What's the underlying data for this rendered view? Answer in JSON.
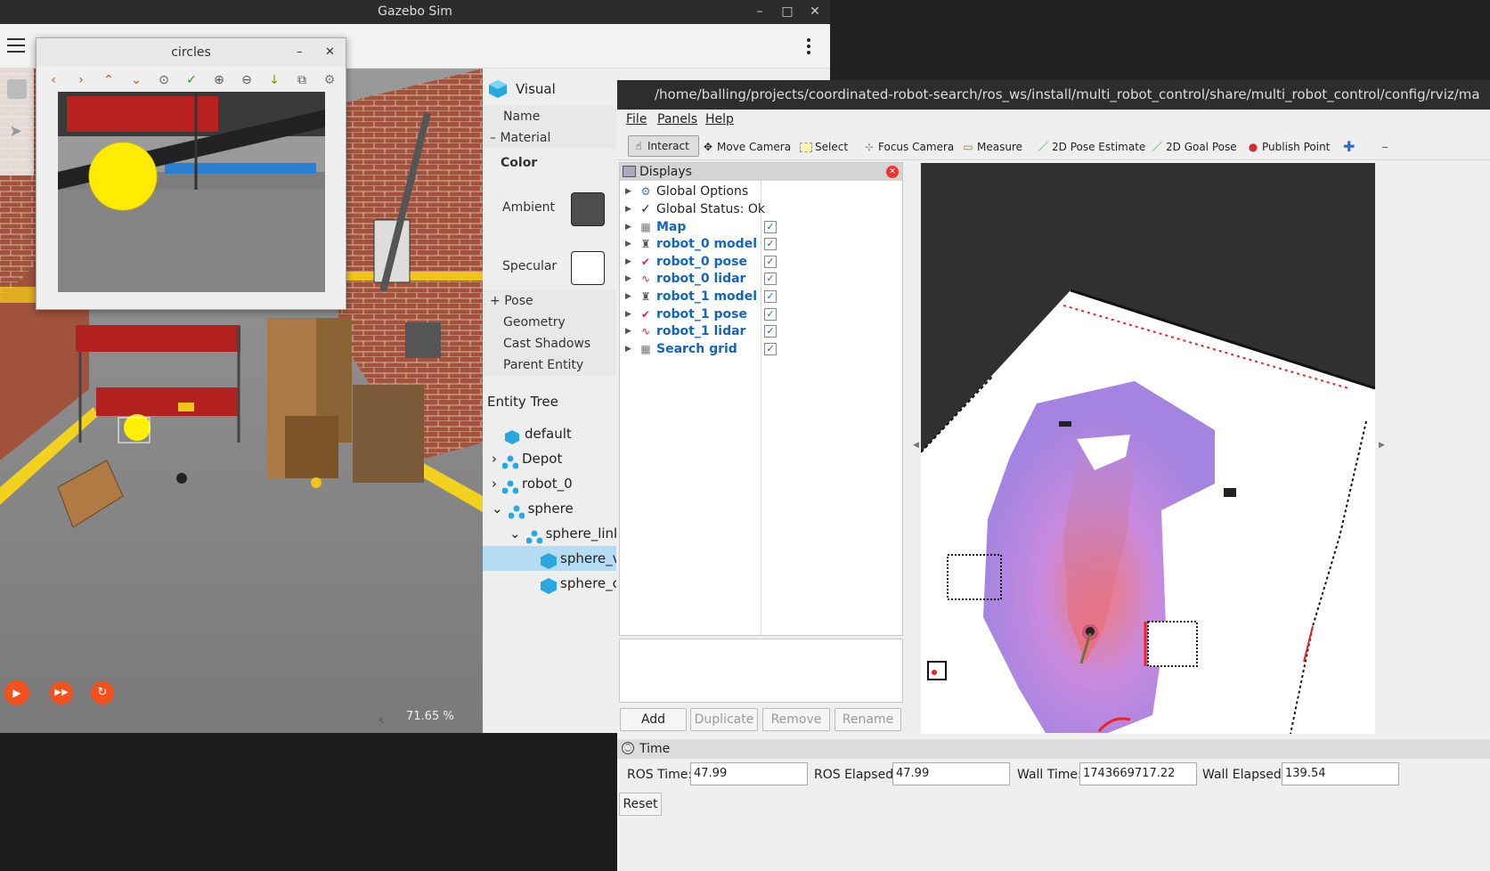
{
  "desktop": {
    "bg": "#1f1f1f"
  },
  "gazebo": {
    "title": "Gazebo Sim",
    "window_controls": [
      "–",
      "□",
      "✕"
    ],
    "menu_icon": "hamburger-icon",
    "more_icon": "kebab-icon",
    "zoom": "71.65 %",
    "collapse_arrow": "‹",
    "play_controls": [
      "play-icon",
      "step-icon",
      "reset-icon"
    ],
    "left_tools": [
      "box-icon",
      "cursor-icon"
    ],
    "component": {
      "section": "Visual",
      "name_label": "Name",
      "material_label": "Material",
      "material_toggle": "–",
      "color_label": "Color",
      "ambient_label": "Ambient",
      "ambient_color": "#4d4d4d",
      "specular_label": "Specular",
      "specular_color": "#ffffff",
      "pose_label": "Pose",
      "pose_toggle": "+",
      "geometry_label": "Geometry",
      "cast_shadows_label": "Cast Shadows",
      "parent_entity_label": "Parent Entity"
    },
    "entity_tree": {
      "title": "Entity Tree",
      "items": [
        {
          "label": "default",
          "chevron": "",
          "icon": "cube-icon"
        },
        {
          "label": "Depot",
          "chevron": "›",
          "icon": "model-icon"
        },
        {
          "label": "robot_0",
          "chevron": "›",
          "icon": "model-icon"
        },
        {
          "label": "sphere",
          "chevron": "⌄",
          "icon": "model-icon"
        },
        {
          "label": "sphere_link",
          "chevron": "⌄",
          "icon": "link-icon"
        },
        {
          "label": "sphere_v",
          "chevron": "",
          "icon": "visual-icon",
          "selected": true
        },
        {
          "label": "sphere_c",
          "chevron": "",
          "icon": "collision-icon"
        }
      ]
    }
  },
  "circles": {
    "title": "circles",
    "controls": [
      "–",
      "✕"
    ],
    "tools": [
      "‹",
      "›",
      "⌃",
      "⌄",
      "⊙",
      "✓",
      "⊕",
      "⊖",
      "↓",
      "⧉",
      "⚙"
    ]
  },
  "rviz": {
    "title": "/home/balling/projects/coordinated-robot-search/ros_ws/install/multi_robot_control/share/multi_robot_control/config/rviz/ma",
    "menu": [
      "File",
      "Panels",
      "Help"
    ],
    "tools": [
      {
        "label": "Interact",
        "icon": "interact-icon",
        "active": true
      },
      {
        "label": "Move Camera",
        "icon": "move-camera-icon"
      },
      {
        "label": "Select",
        "icon": "select-icon"
      },
      {
        "label": "Focus Camera",
        "icon": "focus-camera-icon"
      },
      {
        "label": "Measure",
        "icon": "measure-icon"
      },
      {
        "label": "2D Pose Estimate",
        "icon": "pose-estimate-icon"
      },
      {
        "label": "2D Goal Pose",
        "icon": "goal-pose-icon"
      },
      {
        "label": "Publish Point",
        "icon": "publish-point-icon"
      }
    ],
    "displays": {
      "title": "Displays",
      "items": [
        {
          "label": "Global Options",
          "icon": "gear-icon",
          "bold": false,
          "checked": null
        },
        {
          "label": "Global Status: Ok",
          "icon": "check-icon",
          "bold": false,
          "checked": null
        },
        {
          "label": "Map",
          "icon": "map-icon",
          "bold": true,
          "checked": true
        },
        {
          "label": "robot_0 model",
          "icon": "robot-model-icon",
          "bold": true,
          "checked": true
        },
        {
          "label": "robot_0 pose",
          "icon": "pose-icon",
          "bold": true,
          "checked": true
        },
        {
          "label": "robot_0 lidar",
          "icon": "lidar-icon",
          "bold": true,
          "checked": true
        },
        {
          "label": "robot_1 model",
          "icon": "robot-model-icon",
          "bold": true,
          "checked": true
        },
        {
          "label": "robot_1 pose",
          "icon": "pose-icon",
          "bold": true,
          "checked": true
        },
        {
          "label": "robot_1 lidar",
          "icon": "lidar-icon",
          "bold": true,
          "checked": true
        },
        {
          "label": "Search grid",
          "icon": "map-icon",
          "bold": true,
          "checked": true
        }
      ]
    },
    "buttons": [
      "Add",
      "Duplicate",
      "Remove",
      "Rename"
    ],
    "time": {
      "title": "Time",
      "ros_time_label": "ROS Time:",
      "ros_time": "47.99",
      "ros_elapsed_label": "ROS Elapsed:",
      "ros_elapsed": "47.99",
      "wall_time_label": "Wall Time:",
      "wall_time": "1743669717.22",
      "wall_elapsed_label": "Wall Elapsed:",
      "wall_elapsed": "139.54",
      "reset": "Reset"
    }
  }
}
